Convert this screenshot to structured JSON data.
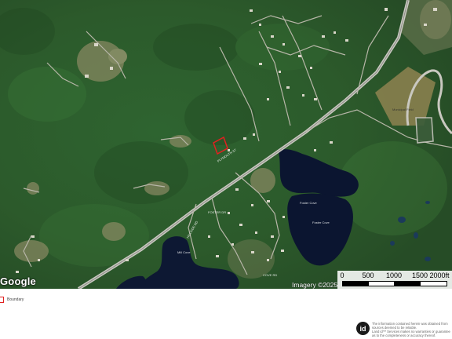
{
  "map": {
    "provider_logo": "Google",
    "attribution": "Imagery ©2025",
    "scale": {
      "labels": [
        "0",
        "500",
        "1000",
        "1500",
        "2000ft"
      ]
    },
    "labels": {
      "main_road": "PLYMOUTH ST",
      "road_2": "FOSTER DR",
      "road_3": "COVE RD",
      "road_4": "HILLSIDE RD",
      "pond_1": "Foster Cove",
      "pond_2": "Foster Cove",
      "pond_3": "Mill Cove",
      "field": "Municipal Field"
    },
    "parcel_color": "#e32020"
  },
  "legend": {
    "boundary_label": "Boundary"
  },
  "disclaimer": {
    "badge": "id",
    "lines": [
      "The information contained herein was obtained from",
      "sources deemed to be reliable.",
      "Land id™ Services makes no warranties or guarantees",
      "as to the completeness or accuracy thereof."
    ]
  }
}
